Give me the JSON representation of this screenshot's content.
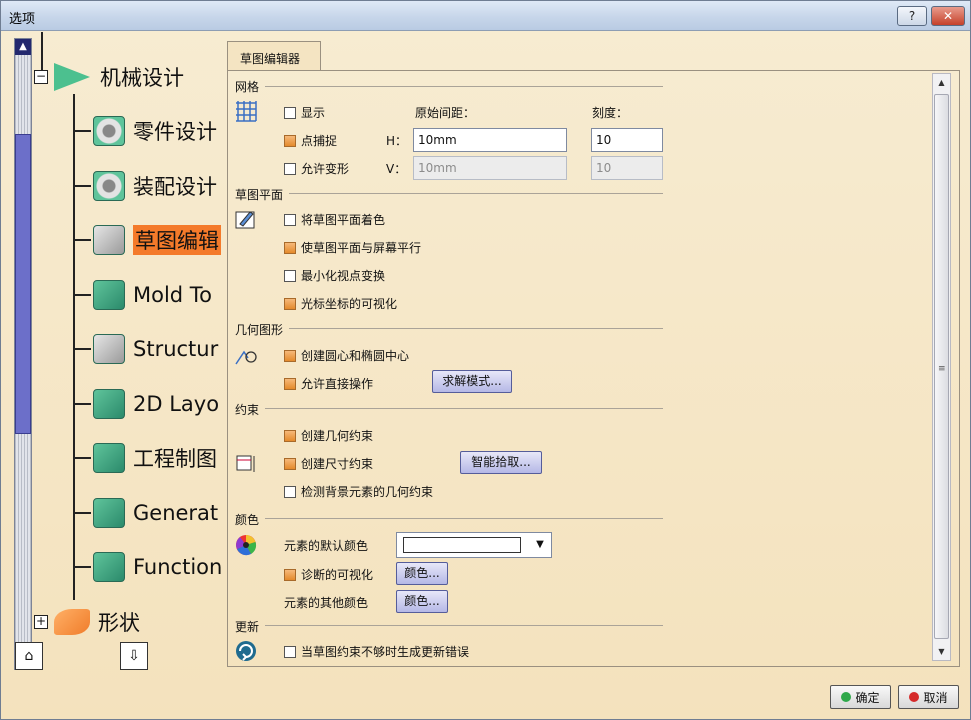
{
  "window": {
    "title": "选项",
    "help_label": "?",
    "close_label": "✕"
  },
  "tree": {
    "items": [
      {
        "label": "机械设计",
        "icon": "mechanical-design-icon"
      },
      {
        "label": "零件设计",
        "icon": "part-design-icon"
      },
      {
        "label": "装配设计",
        "icon": "assembly-design-icon"
      },
      {
        "label": "草图编辑",
        "icon": "sketcher-icon",
        "selected": true
      },
      {
        "label": "Mold To",
        "icon": "mold-tooling-icon"
      },
      {
        "label": "Structur",
        "icon": "structure-icon"
      },
      {
        "label": "2D Layo",
        "icon": "2d-layout-icon"
      },
      {
        "label": "工程制图",
        "icon": "drafting-icon"
      },
      {
        "label": "Generat",
        "icon": "generative-icon"
      },
      {
        "label": "Function",
        "icon": "functional-icon"
      },
      {
        "label": "形状",
        "icon": "shape-icon"
      }
    ]
  },
  "tab": {
    "label": "草图编辑器"
  },
  "grid": {
    "section": "网格",
    "show_label": "显示",
    "orig_spacing_label": "原始间距：",
    "scale_label": "刻度：",
    "snap_label": "点捕捉",
    "h_label": "H：",
    "h_value": "10mm",
    "h_scale": "10",
    "allow_distort_label": "允许变形",
    "v_label": "V：",
    "v_value": "10mm",
    "v_scale": "10"
  },
  "sketch_plane": {
    "section": "草图平面",
    "shade_label": "将草图平面着色",
    "parallel_label": "使草图平面与屏幕平行",
    "minimize_label": "最小化视点变换",
    "cursor_coord_label": "光标坐标的可视化"
  },
  "geometry": {
    "section": "几何图形",
    "create_centers_label": "创建圆心和椭圆中心",
    "allow_direct_label": "允许直接操作",
    "solve_mode_button": "求解模式..."
  },
  "constraint": {
    "section": "约束",
    "geometric_label": "创建几何约束",
    "dimension_label": "创建尺寸约束",
    "smart_pick_button": "智能拾取...",
    "background_label": "检测背景元素的几何约束"
  },
  "colors": {
    "section": "颜色",
    "default_color_label": "元素的默认颜色",
    "diagnosis_label": "诊断的可视化",
    "color_button_1": "颜色...",
    "other_colors_label": "元素的其他颜色",
    "color_button_2": "颜色..."
  },
  "update": {
    "section": "更新",
    "error_label": "当草图约束不够时生成更新错误"
  },
  "footer": {
    "ok_label": "确定",
    "cancel_label": "取消"
  }
}
